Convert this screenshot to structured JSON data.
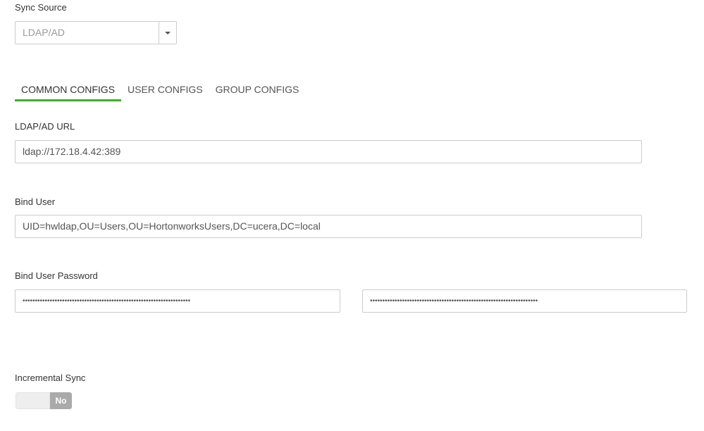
{
  "sync_source": {
    "label": "Sync Source",
    "selected": "LDAP/AD"
  },
  "tabs": [
    {
      "label": "COMMON CONFIGS",
      "active": true
    },
    {
      "label": "USER CONFIGS",
      "active": false
    },
    {
      "label": "GROUP CONFIGS",
      "active": false
    }
  ],
  "ldap_url": {
    "label": "LDAP/AD URL",
    "value": "ldap://172.18.4.42:389"
  },
  "bind_user": {
    "label": "Bind User",
    "value": "UID=hwldap,OU=Users,OU=HortonworksUsers,DC=ucera,DC=local"
  },
  "bind_password": {
    "label": "Bind User Password",
    "value": "••••••••••••••••••••••••••••••••••••••••••••••••••••••••••••••••••••",
    "confirm_value": "••••••••••••••••••••••••••••••••••••••••••••••••••••••••••••••••••••"
  },
  "incremental_sync": {
    "label": "Incremental Sync",
    "state": "No"
  },
  "colors": {
    "active_tab_underline": "#3fae2a",
    "toggle_off": "#aaaaaa"
  }
}
